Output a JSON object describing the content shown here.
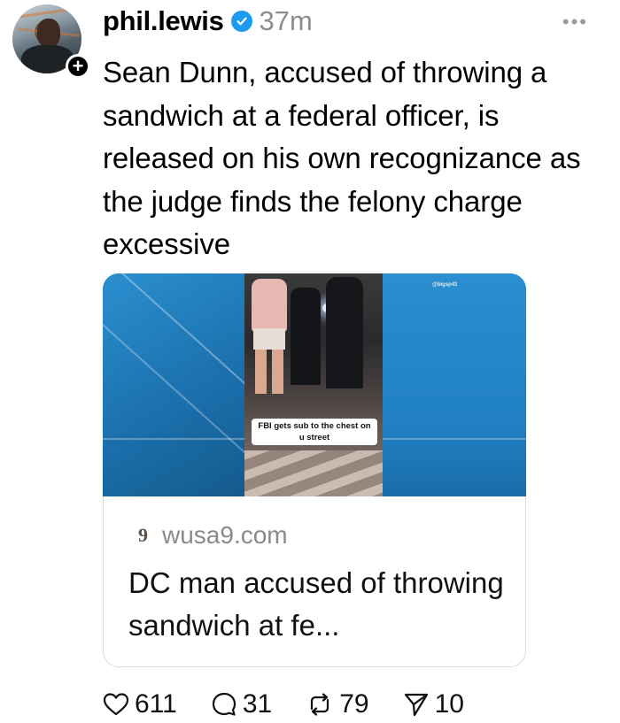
{
  "post": {
    "username": "phil.lewis",
    "timestamp": "37m",
    "text": "Sean Dunn, accused of throwing a sandwich at a federal officer, is released on his own recognizance as the judge finds the felony charge excessive"
  },
  "media": {
    "caption": "FBI gets sub to the chest on u street",
    "watermark": "@bigsp41"
  },
  "link_card": {
    "source_icon_text": "9",
    "source": "wusa9.com",
    "headline": "DC man accused of throwing sandwich at fe..."
  },
  "actions": {
    "likes": "611",
    "comments": "31",
    "reposts": "79",
    "shares": "10"
  },
  "colors": {
    "verified": "#1d9bf0",
    "muted_text": "#8e8e8e",
    "media_blue": "#1e7fc1"
  },
  "icons": [
    "avatar",
    "follow-plus-icon",
    "verified-icon",
    "more-icon",
    "heart-icon",
    "comment-icon",
    "repost-icon",
    "share-icon"
  ]
}
